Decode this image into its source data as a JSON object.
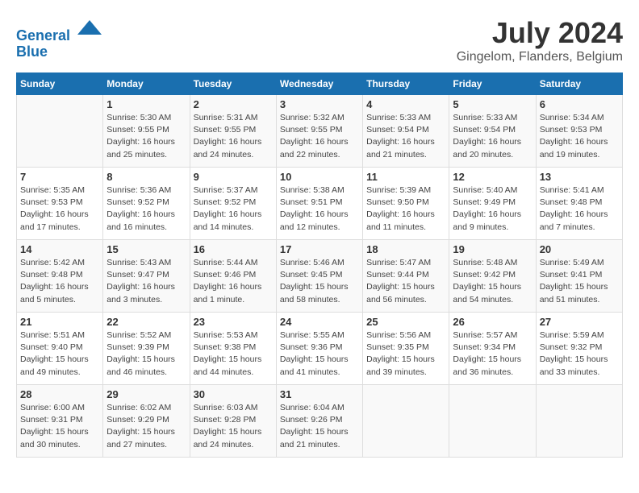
{
  "header": {
    "logo_line1": "General",
    "logo_line2": "Blue",
    "month": "July 2024",
    "location": "Gingelom, Flanders, Belgium"
  },
  "weekdays": [
    "Sunday",
    "Monday",
    "Tuesday",
    "Wednesday",
    "Thursday",
    "Friday",
    "Saturday"
  ],
  "weeks": [
    [
      {
        "day": "",
        "sunrise": "",
        "sunset": "",
        "daylight": ""
      },
      {
        "day": "1",
        "sunrise": "Sunrise: 5:30 AM",
        "sunset": "Sunset: 9:55 PM",
        "daylight": "Daylight: 16 hours and 25 minutes."
      },
      {
        "day": "2",
        "sunrise": "Sunrise: 5:31 AM",
        "sunset": "Sunset: 9:55 PM",
        "daylight": "Daylight: 16 hours and 24 minutes."
      },
      {
        "day": "3",
        "sunrise": "Sunrise: 5:32 AM",
        "sunset": "Sunset: 9:55 PM",
        "daylight": "Daylight: 16 hours and 22 minutes."
      },
      {
        "day": "4",
        "sunrise": "Sunrise: 5:33 AM",
        "sunset": "Sunset: 9:54 PM",
        "daylight": "Daylight: 16 hours and 21 minutes."
      },
      {
        "day": "5",
        "sunrise": "Sunrise: 5:33 AM",
        "sunset": "Sunset: 9:54 PM",
        "daylight": "Daylight: 16 hours and 20 minutes."
      },
      {
        "day": "6",
        "sunrise": "Sunrise: 5:34 AM",
        "sunset": "Sunset: 9:53 PM",
        "daylight": "Daylight: 16 hours and 19 minutes."
      }
    ],
    [
      {
        "day": "7",
        "sunrise": "Sunrise: 5:35 AM",
        "sunset": "Sunset: 9:53 PM",
        "daylight": "Daylight: 16 hours and 17 minutes."
      },
      {
        "day": "8",
        "sunrise": "Sunrise: 5:36 AM",
        "sunset": "Sunset: 9:52 PM",
        "daylight": "Daylight: 16 hours and 16 minutes."
      },
      {
        "day": "9",
        "sunrise": "Sunrise: 5:37 AM",
        "sunset": "Sunset: 9:52 PM",
        "daylight": "Daylight: 16 hours and 14 minutes."
      },
      {
        "day": "10",
        "sunrise": "Sunrise: 5:38 AM",
        "sunset": "Sunset: 9:51 PM",
        "daylight": "Daylight: 16 hours and 12 minutes."
      },
      {
        "day": "11",
        "sunrise": "Sunrise: 5:39 AM",
        "sunset": "Sunset: 9:50 PM",
        "daylight": "Daylight: 16 hours and 11 minutes."
      },
      {
        "day": "12",
        "sunrise": "Sunrise: 5:40 AM",
        "sunset": "Sunset: 9:49 PM",
        "daylight": "Daylight: 16 hours and 9 minutes."
      },
      {
        "day": "13",
        "sunrise": "Sunrise: 5:41 AM",
        "sunset": "Sunset: 9:48 PM",
        "daylight": "Daylight: 16 hours and 7 minutes."
      }
    ],
    [
      {
        "day": "14",
        "sunrise": "Sunrise: 5:42 AM",
        "sunset": "Sunset: 9:48 PM",
        "daylight": "Daylight: 16 hours and 5 minutes."
      },
      {
        "day": "15",
        "sunrise": "Sunrise: 5:43 AM",
        "sunset": "Sunset: 9:47 PM",
        "daylight": "Daylight: 16 hours and 3 minutes."
      },
      {
        "day": "16",
        "sunrise": "Sunrise: 5:44 AM",
        "sunset": "Sunset: 9:46 PM",
        "daylight": "Daylight: 16 hours and 1 minute."
      },
      {
        "day": "17",
        "sunrise": "Sunrise: 5:46 AM",
        "sunset": "Sunset: 9:45 PM",
        "daylight": "Daylight: 15 hours and 58 minutes."
      },
      {
        "day": "18",
        "sunrise": "Sunrise: 5:47 AM",
        "sunset": "Sunset: 9:44 PM",
        "daylight": "Daylight: 15 hours and 56 minutes."
      },
      {
        "day": "19",
        "sunrise": "Sunrise: 5:48 AM",
        "sunset": "Sunset: 9:42 PM",
        "daylight": "Daylight: 15 hours and 54 minutes."
      },
      {
        "day": "20",
        "sunrise": "Sunrise: 5:49 AM",
        "sunset": "Sunset: 9:41 PM",
        "daylight": "Daylight: 15 hours and 51 minutes."
      }
    ],
    [
      {
        "day": "21",
        "sunrise": "Sunrise: 5:51 AM",
        "sunset": "Sunset: 9:40 PM",
        "daylight": "Daylight: 15 hours and 49 minutes."
      },
      {
        "day": "22",
        "sunrise": "Sunrise: 5:52 AM",
        "sunset": "Sunset: 9:39 PM",
        "daylight": "Daylight: 15 hours and 46 minutes."
      },
      {
        "day": "23",
        "sunrise": "Sunrise: 5:53 AM",
        "sunset": "Sunset: 9:38 PM",
        "daylight": "Daylight: 15 hours and 44 minutes."
      },
      {
        "day": "24",
        "sunrise": "Sunrise: 5:55 AM",
        "sunset": "Sunset: 9:36 PM",
        "daylight": "Daylight: 15 hours and 41 minutes."
      },
      {
        "day": "25",
        "sunrise": "Sunrise: 5:56 AM",
        "sunset": "Sunset: 9:35 PM",
        "daylight": "Daylight: 15 hours and 39 minutes."
      },
      {
        "day": "26",
        "sunrise": "Sunrise: 5:57 AM",
        "sunset": "Sunset: 9:34 PM",
        "daylight": "Daylight: 15 hours and 36 minutes."
      },
      {
        "day": "27",
        "sunrise": "Sunrise: 5:59 AM",
        "sunset": "Sunset: 9:32 PM",
        "daylight": "Daylight: 15 hours and 33 minutes."
      }
    ],
    [
      {
        "day": "28",
        "sunrise": "Sunrise: 6:00 AM",
        "sunset": "Sunset: 9:31 PM",
        "daylight": "Daylight: 15 hours and 30 minutes."
      },
      {
        "day": "29",
        "sunrise": "Sunrise: 6:02 AM",
        "sunset": "Sunset: 9:29 PM",
        "daylight": "Daylight: 15 hours and 27 minutes."
      },
      {
        "day": "30",
        "sunrise": "Sunrise: 6:03 AM",
        "sunset": "Sunset: 9:28 PM",
        "daylight": "Daylight: 15 hours and 24 minutes."
      },
      {
        "day": "31",
        "sunrise": "Sunrise: 6:04 AM",
        "sunset": "Sunset: 9:26 PM",
        "daylight": "Daylight: 15 hours and 21 minutes."
      },
      {
        "day": "",
        "sunrise": "",
        "sunset": "",
        "daylight": ""
      },
      {
        "day": "",
        "sunrise": "",
        "sunset": "",
        "daylight": ""
      },
      {
        "day": "",
        "sunrise": "",
        "sunset": "",
        "daylight": ""
      }
    ]
  ]
}
